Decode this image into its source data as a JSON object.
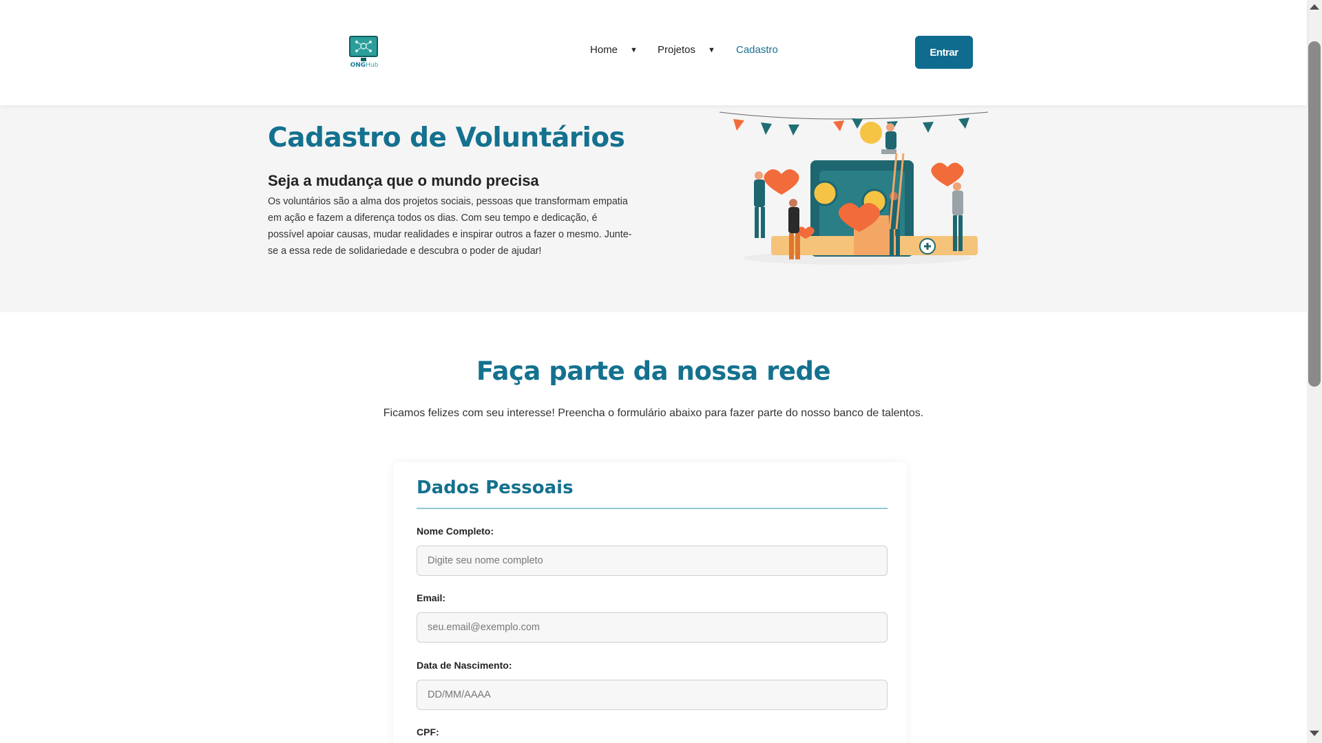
{
  "header": {
    "logo": {
      "text_main": "ONG",
      "text_accent": "Hub",
      "icon": "monitor-network-icon"
    },
    "nav": [
      {
        "label": "Home",
        "caret": "▼"
      },
      {
        "label": "Projetos",
        "caret": "▼"
      },
      {
        "label": "Cadastro"
      }
    ],
    "login_button": "Entrar"
  },
  "hero": {
    "title": "Cadastro de Voluntários",
    "subtitle": "Seja a mudança que o mundo precisa",
    "text": "Os voluntários são a alma dos projetos sociais, pessoas que transformam empatia em ação e fazem a diferença todos os dias. Com seu tempo e dedicação, é possível apoiar causas, mudar realidades e inspirar outros a fazer o mesmo. Junte-se a essa rede de solidariedade e descubra o poder de ajudar!",
    "illustration": "volunteers-illustration"
  },
  "main": {
    "title": "Faça parte da nossa rede",
    "description": "Ficamos felizes com seu interesse! Preencha o formulário abaixo para fazer parte do nosso banco de talentos."
  },
  "form": {
    "section_title": "Dados Pessoais",
    "fields": [
      {
        "label": "Nome Completo:",
        "placeholder": "Digite seu nome completo",
        "value": ""
      },
      {
        "label": "Email:",
        "placeholder": "seu.email@exemplo.com",
        "value": ""
      },
      {
        "label": "Data de Nascimento:",
        "placeholder": "DD/MM/AAAA",
        "value": ""
      },
      {
        "label": "CPF:"
      }
    ]
  },
  "colors": {
    "primary": "#14718f",
    "button": "#0f6c8f",
    "hero_bg": "#f5f5f5",
    "accent_orange": "#f26b3a",
    "accent_yellow": "#f6c445"
  }
}
